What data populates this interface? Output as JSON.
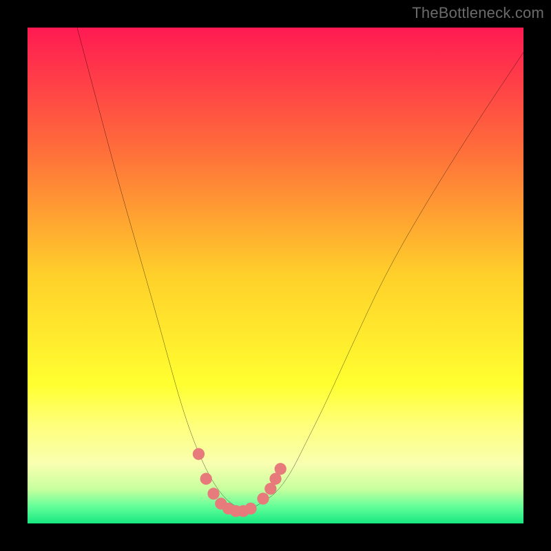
{
  "watermark": "TheBottleneck.com",
  "chart_data": {
    "type": "line",
    "title": "",
    "xlabel": "",
    "ylabel": "",
    "xlim": [
      0,
      100
    ],
    "ylim": [
      0,
      100
    ],
    "grid": false,
    "legend": false,
    "background_gradient_stops": [
      {
        "offset": 0.0,
        "color": "#ff1a52"
      },
      {
        "offset": 0.25,
        "color": "#ff6f3a"
      },
      {
        "offset": 0.5,
        "color": "#ffd02a"
      },
      {
        "offset": 0.72,
        "color": "#ffff30"
      },
      {
        "offset": 0.8,
        "color": "#ffff7a"
      },
      {
        "offset": 0.88,
        "color": "#f8ffb0"
      },
      {
        "offset": 0.93,
        "color": "#c9ff9e"
      },
      {
        "offset": 0.965,
        "color": "#66ff9a"
      },
      {
        "offset": 1.0,
        "color": "#17e880"
      }
    ],
    "series": [
      {
        "name": "bottleneck-curve",
        "color": "#000000",
        "x": [
          10,
          14,
          18,
          22,
          26,
          29,
          31,
          33,
          35,
          37,
          39,
          41,
          43,
          45,
          47,
          50,
          53,
          56,
          60,
          65,
          72,
          80,
          90,
          100
        ],
        "values": [
          100,
          85,
          70,
          56,
          42,
          31,
          24,
          18,
          13,
          9,
          6,
          4,
          3,
          3,
          4,
          6,
          10,
          16,
          24,
          35,
          50,
          64,
          80,
          95
        ]
      }
    ],
    "markers": {
      "name": "near-minimum-dots",
      "color": "#e77a7a",
      "radius_pct": 1.2,
      "points": [
        {
          "x": 34.5,
          "y": 14
        },
        {
          "x": 36.0,
          "y": 9
        },
        {
          "x": 37.5,
          "y": 6
        },
        {
          "x": 39.0,
          "y": 4
        },
        {
          "x": 40.5,
          "y": 3
        },
        {
          "x": 42.0,
          "y": 2.5
        },
        {
          "x": 43.5,
          "y": 2.5
        },
        {
          "x": 45.0,
          "y": 3
        },
        {
          "x": 47.5,
          "y": 5
        },
        {
          "x": 49.0,
          "y": 7
        },
        {
          "x": 50.0,
          "y": 9
        },
        {
          "x": 51.0,
          "y": 11
        }
      ]
    }
  }
}
